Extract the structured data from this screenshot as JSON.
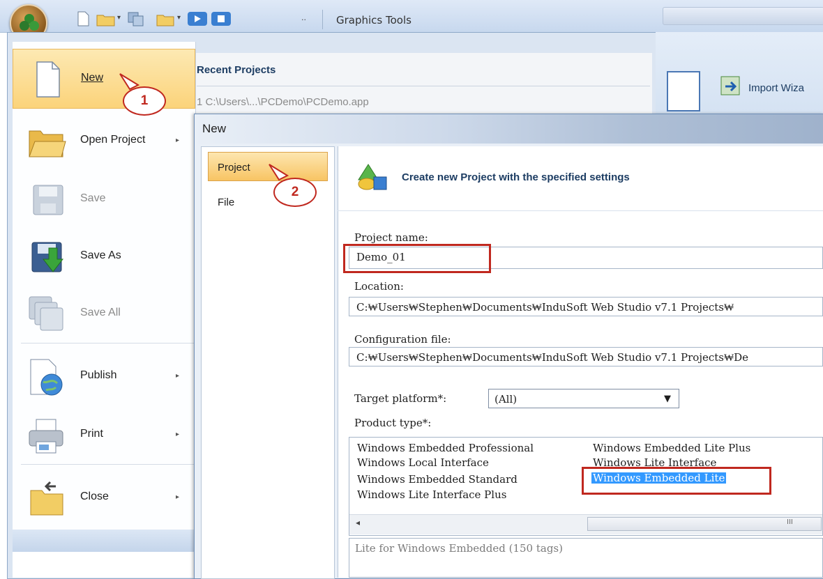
{
  "window": {
    "context_tab": "Graphics Tools"
  },
  "quick_access": {
    "overflow_glyph": "··"
  },
  "office_menu": {
    "items": [
      {
        "label": "New",
        "icon": "new-document-icon",
        "submenu": false
      },
      {
        "label": "Open Project",
        "icon": "open-folder-icon",
        "submenu": true,
        "submenu_glyph": "▸"
      },
      {
        "label": "Save",
        "icon": "save-disk-icon",
        "submenu": false,
        "disabled": true
      },
      {
        "label": "Save As",
        "icon": "save-as-icon",
        "submenu": false
      },
      {
        "label": "Save All",
        "icon": "save-all-icon",
        "submenu": false,
        "disabled": true
      },
      {
        "label": "Publish",
        "icon": "publish-globe-icon",
        "submenu": true,
        "submenu_glyph": "▸"
      },
      {
        "label": "Print",
        "icon": "printer-icon",
        "submenu": true,
        "submenu_glyph": "▸"
      },
      {
        "label": "Close",
        "icon": "close-folder-icon",
        "submenu": true,
        "submenu_glyph": "▸"
      }
    ],
    "recent": {
      "title": "Recent Projects",
      "items": [
        "1 C:\\Users\\...\\PCDemo\\PCDemo.app"
      ]
    }
  },
  "ribbon": {
    "import_label": "Import Wiza"
  },
  "dialog": {
    "title": "New",
    "nav": [
      {
        "label": "Project",
        "selected": true
      },
      {
        "label": "File",
        "selected": false
      }
    ],
    "header": "Create new Project with the specified settings",
    "project_name": {
      "label": "Project name:",
      "value": "Demo_01"
    },
    "location": {
      "label": "Location:",
      "value": "C:₩Users₩Stephen₩Documents₩InduSoft Web Studio v7.1 Projects₩"
    },
    "config_file": {
      "label": "Configuration file:",
      "value": "C:₩Users₩Stephen₩Documents₩InduSoft Web Studio v7.1 Projects₩De"
    },
    "target_platform": {
      "label": "Target platform*:",
      "value": "(All)",
      "dropdown_glyph": "▼"
    },
    "product_type": {
      "label": "Product type*:",
      "col1": [
        "Windows Embedded Professional",
        "Windows Local Interface",
        "Windows Embedded Standard",
        "Windows Lite Interface Plus"
      ],
      "col2": [
        "Windows Embedded Lite Plus",
        "Windows Lite Interface",
        "Windows Embedded Lite"
      ],
      "selected": "Windows Embedded Lite"
    },
    "scrollbar": {
      "left_glyph": "◂",
      "thumb_glyph": "III"
    },
    "description": "Lite for Windows Embedded (150 tags)"
  },
  "annotations": {
    "step1": "1",
    "step2": "2",
    "accent": "#c0281f"
  }
}
